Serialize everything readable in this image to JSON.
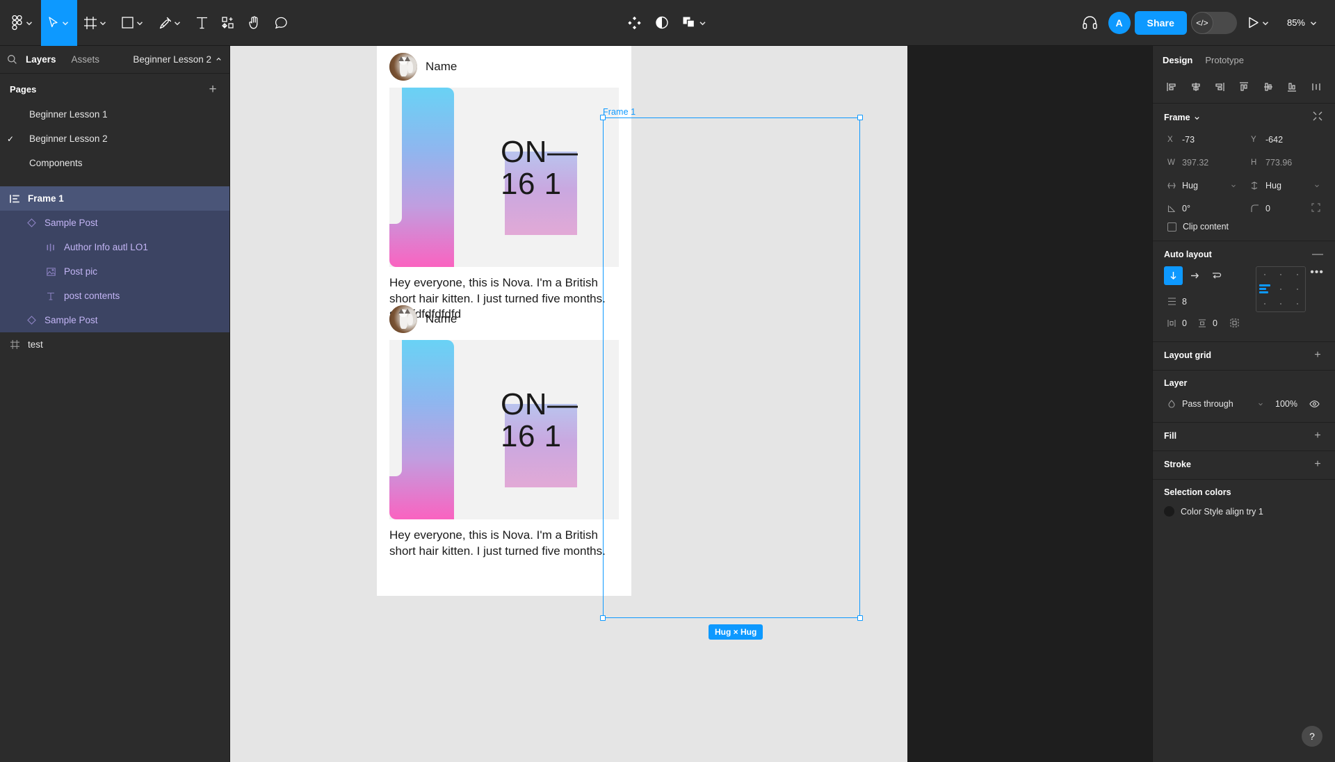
{
  "toolbar": {
    "left_tools": [
      {
        "name": "figma-menu-icon",
        "label": "",
        "has_chevron": true,
        "active": false
      },
      {
        "name": "move-tool-icon",
        "label": "",
        "has_chevron": true,
        "active": true
      },
      {
        "name": "frame-tool-icon",
        "label": "",
        "has_chevron": true,
        "active": false
      },
      {
        "name": "shape-tool-icon",
        "label": "",
        "has_chevron": true,
        "active": false
      },
      {
        "name": "pen-tool-icon",
        "label": "",
        "has_chevron": true,
        "active": false
      },
      {
        "name": "text-tool-icon",
        "label": "",
        "has_chevron": false,
        "active": false
      },
      {
        "name": "resources-tool-icon",
        "label": "",
        "has_chevron": false,
        "active": false
      },
      {
        "name": "hand-tool-icon",
        "label": "",
        "has_chevron": false,
        "active": false
      },
      {
        "name": "comment-tool-icon",
        "label": "",
        "has_chevron": false,
        "active": false
      }
    ],
    "center_tools": [
      {
        "name": "component-icon",
        "has_chevron": false
      },
      {
        "name": "mask-icon",
        "has_chevron": false
      },
      {
        "name": "boolean-union-icon",
        "has_chevron": true
      }
    ],
    "headphones_icon": "headphones-icon",
    "avatar_initial": "A",
    "share_label": "Share",
    "devmode_glyph": "</>",
    "present_icon": "play-icon",
    "zoom_level": "85%"
  },
  "left_panel": {
    "search_icon": "search-icon",
    "tabs": [
      {
        "label": "Layers",
        "active": true
      },
      {
        "label": "Assets",
        "active": false
      }
    ],
    "file_name": "Beginner Lesson 2",
    "pages": {
      "title": "Pages",
      "add_label": "+",
      "items": [
        {
          "label": "Beginner Lesson 1",
          "checked": false
        },
        {
          "label": "Beginner Lesson 2",
          "checked": true
        },
        {
          "label": "Components",
          "checked": false
        }
      ]
    },
    "layers": [
      {
        "label": "Frame 1",
        "icon": "auto-layout-icon",
        "indent": 0,
        "state": "selected"
      },
      {
        "label": "Sample Post",
        "icon": "component-diamond-icon",
        "indent": 1,
        "state": "child"
      },
      {
        "label": "Author Info autl LO1",
        "icon": "component-instance-icon",
        "indent": 2,
        "state": "child"
      },
      {
        "label": "Post pic",
        "icon": "image-icon",
        "indent": 2,
        "state": "child"
      },
      {
        "label": "post contents",
        "icon": "text-icon",
        "indent": 2,
        "state": "child"
      },
      {
        "label": "Sample Post",
        "icon": "component-diamond-icon",
        "indent": 1,
        "state": "child"
      },
      {
        "label": "test",
        "icon": "frame-icon",
        "indent": 0,
        "state": "normal"
      }
    ]
  },
  "canvas": {
    "frame_label": "Frame 1",
    "hug_badge": "Hug × Hug",
    "posts": [
      {
        "author_name": "Name",
        "avatar": "cat-avatar",
        "image_text": "ON—\n16 1",
        "body": "Hey everyone, this is Nova. I'm a British short hair kitten. I just turned five months.\nsdfdfdfdfdfdfd"
      },
      {
        "author_name": "Name",
        "avatar": "cat-avatar",
        "image_text": "ON—\n16 1",
        "body": "Hey everyone, this is Nova. I'm a British short hair kitten. I just turned five months."
      }
    ]
  },
  "right_panel": {
    "tabs": [
      {
        "label": "Design",
        "active": true
      },
      {
        "label": "Prototype",
        "active": false
      }
    ],
    "align_buttons": [
      "align-left-icon",
      "align-horizontal-center-icon",
      "align-right-icon",
      "align-top-icon",
      "align-vertical-center-icon",
      "align-bottom-icon",
      "distribute-icon"
    ],
    "frame": {
      "title": "Frame",
      "collapse_icon": "collapse-icon",
      "x_label": "X",
      "x_value": "-73",
      "y_label": "Y",
      "y_value": "-642",
      "w_label": "W",
      "w_value": "397.32",
      "h_label": "H",
      "h_value": "773.96",
      "hug_width": "Hug",
      "hug_height": "Hug",
      "rotation": "0°",
      "corner_radius": "0",
      "independent_corners_icon": "independent-corners-icon",
      "clip_content_label": "Clip content",
      "clip_content_checked": false
    },
    "auto_layout": {
      "title": "Auto layout",
      "remove_label": "—",
      "direction_vertical_icon": "arrow-down-icon",
      "direction_horizontal_icon": "arrow-right-icon",
      "direction_wrap_icon": "wrap-icon",
      "more_label": "•••",
      "gap_label": "gap-icon",
      "gap_value": "8",
      "padding_h_label": "horizontal-padding-icon",
      "padding_h_value": "0",
      "padding_v_label": "vertical-padding-icon",
      "padding_v_value": "0",
      "padding_more_icon": "individual-padding-icon"
    },
    "layout_grid": {
      "title": "Layout grid",
      "add_label": "+"
    },
    "layer": {
      "title": "Layer",
      "blend_mode": "Pass through",
      "opacity": "100%",
      "visibility_icon": "eye-icon"
    },
    "fill": {
      "title": "Fill",
      "add_label": "+"
    },
    "stroke": {
      "title": "Stroke",
      "add_label": "+"
    },
    "selection_colors": {
      "title": "Selection colors",
      "items": [
        {
          "label": "Color Style align try 1",
          "color": "#1a1a1a"
        }
      ]
    },
    "help_label": "?"
  }
}
